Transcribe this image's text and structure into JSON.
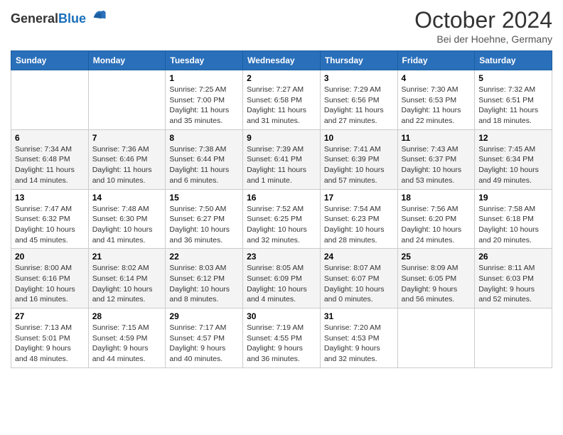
{
  "header": {
    "logo": {
      "general": "General",
      "blue": "Blue"
    },
    "title": "October 2024",
    "location": "Bei der Hoehne, Germany"
  },
  "weekdays": [
    "Sunday",
    "Monday",
    "Tuesday",
    "Wednesday",
    "Thursday",
    "Friday",
    "Saturday"
  ],
  "weeks": [
    [
      {
        "day": null,
        "info": null
      },
      {
        "day": null,
        "info": null
      },
      {
        "day": "1",
        "sunrise": "Sunrise: 7:25 AM",
        "sunset": "Sunset: 7:00 PM",
        "daylight": "Daylight: 11 hours and 35 minutes."
      },
      {
        "day": "2",
        "sunrise": "Sunrise: 7:27 AM",
        "sunset": "Sunset: 6:58 PM",
        "daylight": "Daylight: 11 hours and 31 minutes."
      },
      {
        "day": "3",
        "sunrise": "Sunrise: 7:29 AM",
        "sunset": "Sunset: 6:56 PM",
        "daylight": "Daylight: 11 hours and 27 minutes."
      },
      {
        "day": "4",
        "sunrise": "Sunrise: 7:30 AM",
        "sunset": "Sunset: 6:53 PM",
        "daylight": "Daylight: 11 hours and 22 minutes."
      },
      {
        "day": "5",
        "sunrise": "Sunrise: 7:32 AM",
        "sunset": "Sunset: 6:51 PM",
        "daylight": "Daylight: 11 hours and 18 minutes."
      }
    ],
    [
      {
        "day": "6",
        "sunrise": "Sunrise: 7:34 AM",
        "sunset": "Sunset: 6:48 PM",
        "daylight": "Daylight: 11 hours and 14 minutes."
      },
      {
        "day": "7",
        "sunrise": "Sunrise: 7:36 AM",
        "sunset": "Sunset: 6:46 PM",
        "daylight": "Daylight: 11 hours and 10 minutes."
      },
      {
        "day": "8",
        "sunrise": "Sunrise: 7:38 AM",
        "sunset": "Sunset: 6:44 PM",
        "daylight": "Daylight: 11 hours and 6 minutes."
      },
      {
        "day": "9",
        "sunrise": "Sunrise: 7:39 AM",
        "sunset": "Sunset: 6:41 PM",
        "daylight": "Daylight: 11 hours and 1 minute."
      },
      {
        "day": "10",
        "sunrise": "Sunrise: 7:41 AM",
        "sunset": "Sunset: 6:39 PM",
        "daylight": "Daylight: 10 hours and 57 minutes."
      },
      {
        "day": "11",
        "sunrise": "Sunrise: 7:43 AM",
        "sunset": "Sunset: 6:37 PM",
        "daylight": "Daylight: 10 hours and 53 minutes."
      },
      {
        "day": "12",
        "sunrise": "Sunrise: 7:45 AM",
        "sunset": "Sunset: 6:34 PM",
        "daylight": "Daylight: 10 hours and 49 minutes."
      }
    ],
    [
      {
        "day": "13",
        "sunrise": "Sunrise: 7:47 AM",
        "sunset": "Sunset: 6:32 PM",
        "daylight": "Daylight: 10 hours and 45 minutes."
      },
      {
        "day": "14",
        "sunrise": "Sunrise: 7:48 AM",
        "sunset": "Sunset: 6:30 PM",
        "daylight": "Daylight: 10 hours and 41 minutes."
      },
      {
        "day": "15",
        "sunrise": "Sunrise: 7:50 AM",
        "sunset": "Sunset: 6:27 PM",
        "daylight": "Daylight: 10 hours and 36 minutes."
      },
      {
        "day": "16",
        "sunrise": "Sunrise: 7:52 AM",
        "sunset": "Sunset: 6:25 PM",
        "daylight": "Daylight: 10 hours and 32 minutes."
      },
      {
        "day": "17",
        "sunrise": "Sunrise: 7:54 AM",
        "sunset": "Sunset: 6:23 PM",
        "daylight": "Daylight: 10 hours and 28 minutes."
      },
      {
        "day": "18",
        "sunrise": "Sunrise: 7:56 AM",
        "sunset": "Sunset: 6:20 PM",
        "daylight": "Daylight: 10 hours and 24 minutes."
      },
      {
        "day": "19",
        "sunrise": "Sunrise: 7:58 AM",
        "sunset": "Sunset: 6:18 PM",
        "daylight": "Daylight: 10 hours and 20 minutes."
      }
    ],
    [
      {
        "day": "20",
        "sunrise": "Sunrise: 8:00 AM",
        "sunset": "Sunset: 6:16 PM",
        "daylight": "Daylight: 10 hours and 16 minutes."
      },
      {
        "day": "21",
        "sunrise": "Sunrise: 8:02 AM",
        "sunset": "Sunset: 6:14 PM",
        "daylight": "Daylight: 10 hours and 12 minutes."
      },
      {
        "day": "22",
        "sunrise": "Sunrise: 8:03 AM",
        "sunset": "Sunset: 6:12 PM",
        "daylight": "Daylight: 10 hours and 8 minutes."
      },
      {
        "day": "23",
        "sunrise": "Sunrise: 8:05 AM",
        "sunset": "Sunset: 6:09 PM",
        "daylight": "Daylight: 10 hours and 4 minutes."
      },
      {
        "day": "24",
        "sunrise": "Sunrise: 8:07 AM",
        "sunset": "Sunset: 6:07 PM",
        "daylight": "Daylight: 10 hours and 0 minutes."
      },
      {
        "day": "25",
        "sunrise": "Sunrise: 8:09 AM",
        "sunset": "Sunset: 6:05 PM",
        "daylight": "Daylight: 9 hours and 56 minutes."
      },
      {
        "day": "26",
        "sunrise": "Sunrise: 8:11 AM",
        "sunset": "Sunset: 6:03 PM",
        "daylight": "Daylight: 9 hours and 52 minutes."
      }
    ],
    [
      {
        "day": "27",
        "sunrise": "Sunrise: 7:13 AM",
        "sunset": "Sunset: 5:01 PM",
        "daylight": "Daylight: 9 hours and 48 minutes."
      },
      {
        "day": "28",
        "sunrise": "Sunrise: 7:15 AM",
        "sunset": "Sunset: 4:59 PM",
        "daylight": "Daylight: 9 hours and 44 minutes."
      },
      {
        "day": "29",
        "sunrise": "Sunrise: 7:17 AM",
        "sunset": "Sunset: 4:57 PM",
        "daylight": "Daylight: 9 hours and 40 minutes."
      },
      {
        "day": "30",
        "sunrise": "Sunrise: 7:19 AM",
        "sunset": "Sunset: 4:55 PM",
        "daylight": "Daylight: 9 hours and 36 minutes."
      },
      {
        "day": "31",
        "sunrise": "Sunrise: 7:20 AM",
        "sunset": "Sunset: 4:53 PM",
        "daylight": "Daylight: 9 hours and 32 minutes."
      },
      {
        "day": null,
        "info": null
      },
      {
        "day": null,
        "info": null
      }
    ]
  ]
}
